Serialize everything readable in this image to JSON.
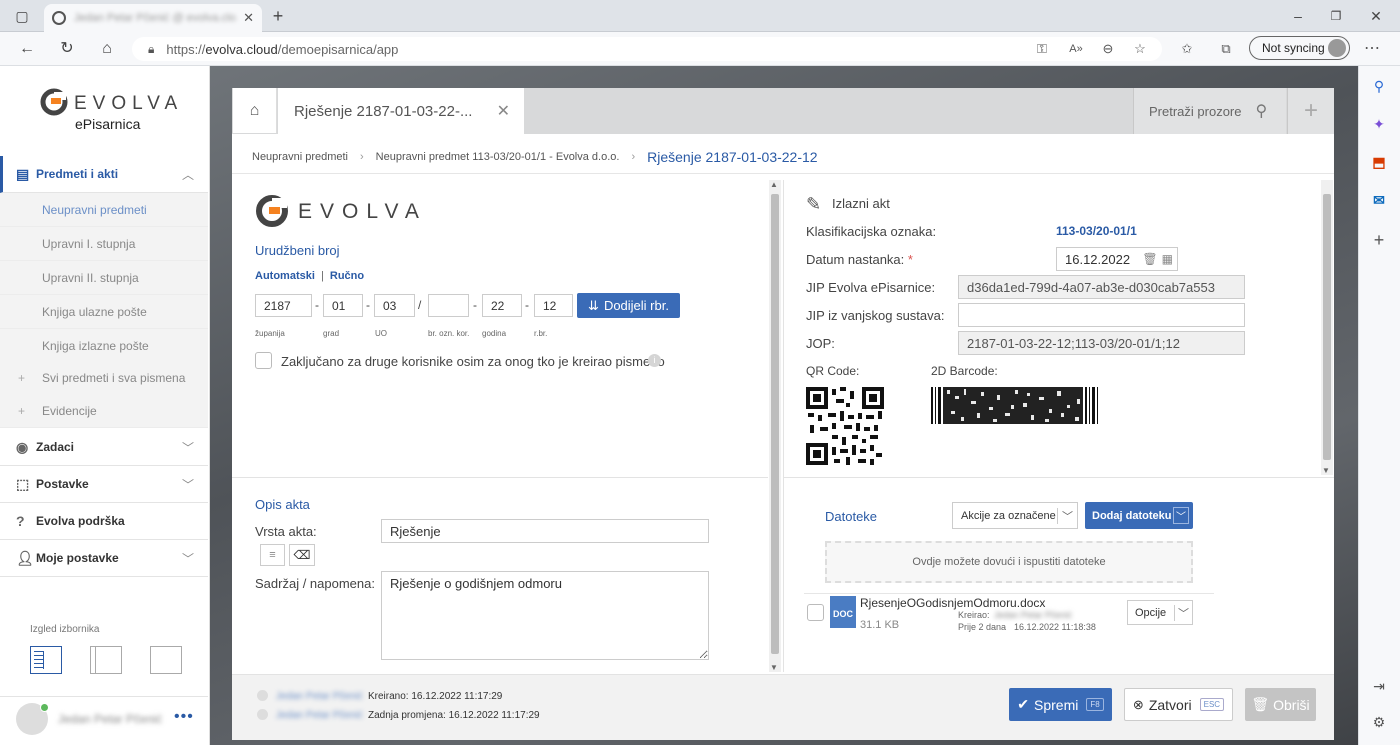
{
  "browser": {
    "tab_title": "Jedan Petar Pčenić @ evolva.clo...",
    "url_scheme": "https://",
    "url_host": "evolva.cloud",
    "url_path": "/demoepisarnica/app",
    "sync_label": "Not syncing"
  },
  "sidebar": {
    "brand": "EVOLVA",
    "product": "ePisarnica",
    "menu": {
      "predmeti": "Predmeti i akti",
      "sub": [
        "Neupravni predmeti",
        "Upravni I. stupnja",
        "Upravni II. stupnja",
        "Knjiga ulazne pošte",
        "Knjiga izlazne pošte"
      ],
      "svi": "Svi predmeti i sva pismena",
      "evidencije": "Evidencije",
      "zadaci": "Zadaci",
      "postavke": "Postavke",
      "podrska": "Evolva podrška",
      "moje": "Moje postavke"
    },
    "layout_label": "Izgled izbornika",
    "user_name": "Jedan Petar Pčenić"
  },
  "window": {
    "tab_title": "Rješenje 2187-01-03-22-...",
    "search_placeholder": "Pretraži prozore"
  },
  "breadcrumb": {
    "items": [
      "Neupravni predmeti",
      "Neupravni predmet 113-03/20-01/1 - Evolva d.o.o."
    ],
    "current": "Rješenje 2187-01-03-22-12"
  },
  "left_form": {
    "brand": "EVOLVA",
    "urudzbeni_title": "Urudžbeni broj",
    "mode_auto": "Automatski",
    "mode_sep": "|",
    "mode_manual": "Ručno",
    "fields": [
      "2187",
      "01",
      "03",
      "",
      "22",
      "12"
    ],
    "separators": [
      "-",
      "-",
      "/",
      "-",
      "-"
    ],
    "field_labels": [
      "županija",
      "grad",
      "UO",
      "br. ozn. kor.",
      "godina",
      "r.br."
    ],
    "assign_button": "Dodijeli rbr.",
    "lock_label": "Zaključano za druge korisnike osim za onog tko je kreirao pismeno",
    "opis_title": "Opis akta",
    "vrsta_label": "Vrsta akta:",
    "vrsta_value": "Rješenje",
    "sadrzaj_label": "Sadržaj / napomena:",
    "sadrzaj_value": "Rješenje o godišnjem odmoru"
  },
  "right_form": {
    "title": "Izlazni akt",
    "klas_label": "Klasifikacijska oznaka:",
    "klas_value": "113-03/20-01/1",
    "datum_label": "Datum nastanka:",
    "required_mark": "*",
    "datum_value": "16.12.2022",
    "jip_label": "JIP Evolva ePisarnice:",
    "jip_value": "d36da1ed-799d-4a07-ab3e-d030cab7a553",
    "jip_ext_label": "JIP iz vanjskog sustava:",
    "jip_ext_value": "",
    "jop_label": "JOP:",
    "jop_value": "2187-01-03-22-12;113-03/20-01/1;12",
    "qr_label": "QR Code:",
    "barcode_label": "2D Barcode:"
  },
  "files": {
    "title": "Datoteke",
    "bulk_actions": "Akcije za označene",
    "add_button": "Dodaj datoteku",
    "drop_hint": "Ovdje možete dovući i ispustiti datoteke",
    "items": [
      {
        "type": "DOC",
        "name": "RjesenjeOGodisnjemOdmoru.docx",
        "size": "31.1 KB",
        "creator_label": "Kreirao:",
        "creator": "Jedan Petar Pčenić",
        "age": "Prije 2 dana",
        "date": "16.12.2022 11:18:38",
        "options": "Opcije"
      }
    ]
  },
  "footer": {
    "created_user": "Jedan Petar Pčenić",
    "created": "Kreirano: 16.12.2022 11:17:29",
    "modified_user": "Jedan Petar Pčenić",
    "modified": "Zadnja promjena: 16.12.2022 11:17:29",
    "save": "Spremi",
    "save_key": "F8",
    "close": "Zatvori",
    "close_key": "ESC",
    "delete": "Obriši"
  },
  "colors": {
    "accent": "#3a6bb7",
    "brand_orange": "#f58220"
  }
}
